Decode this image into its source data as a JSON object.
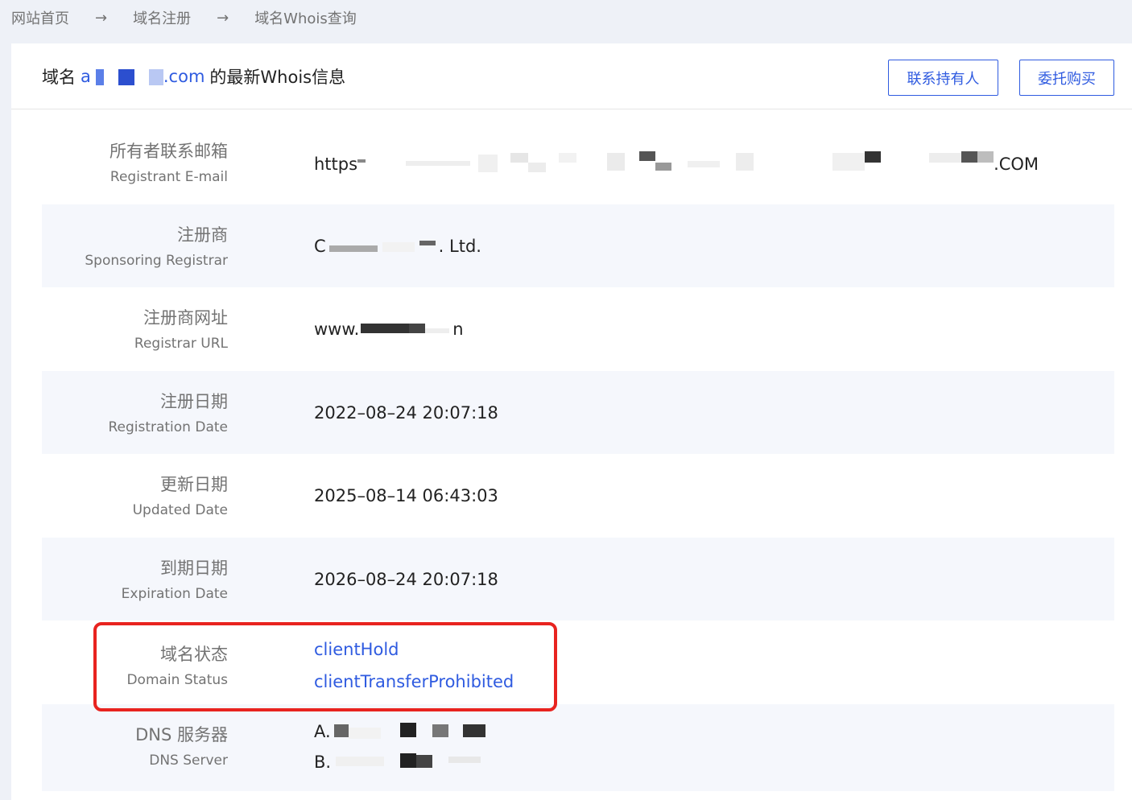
{
  "breadcrumb": {
    "items": [
      "网站首页",
      "域名注册",
      "域名Whois查询"
    ],
    "separator": "→"
  },
  "header": {
    "title_prefix": "域名",
    "domain_visible_start": "a",
    "domain_visible_end": ".com",
    "title_suffix": "的最新Whois信息",
    "contact_button": "联系持有人",
    "entrust_button": "委托购买"
  },
  "rows": [
    {
      "label_cn": "所有者联系邮箱",
      "label_en": "Registrant E-mail",
      "value_start": "https",
      "value_end": ".COM"
    },
    {
      "label_cn": "注册商",
      "label_en": "Sponsoring Registrar",
      "value_start": "C",
      "value_end": ". Ltd."
    },
    {
      "label_cn": "注册商网址",
      "label_en": "Registrar URL",
      "value_start": "www.",
      "value_end": "n"
    },
    {
      "label_cn": "注册日期",
      "label_en": "Registration Date",
      "value": "2022–08–24 20:07:18"
    },
    {
      "label_cn": "更新日期",
      "label_en": "Updated Date",
      "value": "2025–08–14 06:43:03"
    },
    {
      "label_cn": "到期日期",
      "label_en": "Expiration Date",
      "value": "2026–08–24 20:07:18"
    },
    {
      "label_cn": "域名状态",
      "label_en": "Domain Status",
      "values": [
        "clientHold",
        "clientTransferProhibited"
      ]
    },
    {
      "label_cn": "DNS 服务器",
      "label_en": "DNS Server",
      "values_start": [
        "A.",
        "B."
      ]
    }
  ],
  "colors": {
    "accent": "#2f5be0",
    "highlight_border": "#e8231f",
    "alt_row": "#f5f7fc",
    "page_bg": "#eef1f7"
  }
}
